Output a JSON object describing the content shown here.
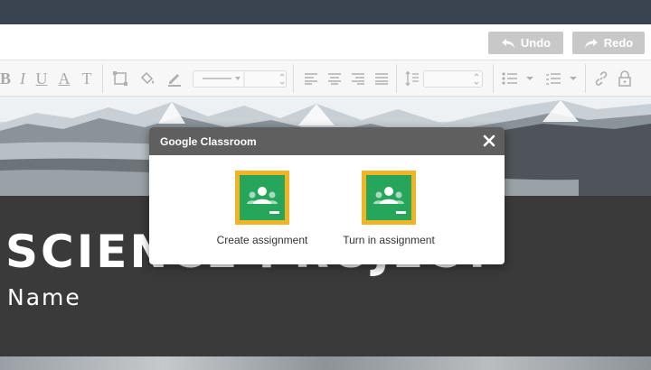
{
  "header": {
    "undo_label": "Undo",
    "redo_label": "Redo",
    "button_color": "#c8c8c8"
  },
  "toolbar": {
    "bold": "B",
    "italic": "I",
    "underline": "U",
    "text_color": "A",
    "clear_format": "T"
  },
  "slide": {
    "title": "SCIENCE PROJECT",
    "subtitle": "Name"
  },
  "dialog": {
    "title": "Google Classroom",
    "options": [
      {
        "label": "Create assignment",
        "icon": "google-classroom-icon"
      },
      {
        "label": "Turn in assignment",
        "icon": "google-classroom-icon"
      }
    ],
    "icon_colors": {
      "frame": "#f2b424",
      "board": "#26a65b"
    }
  }
}
